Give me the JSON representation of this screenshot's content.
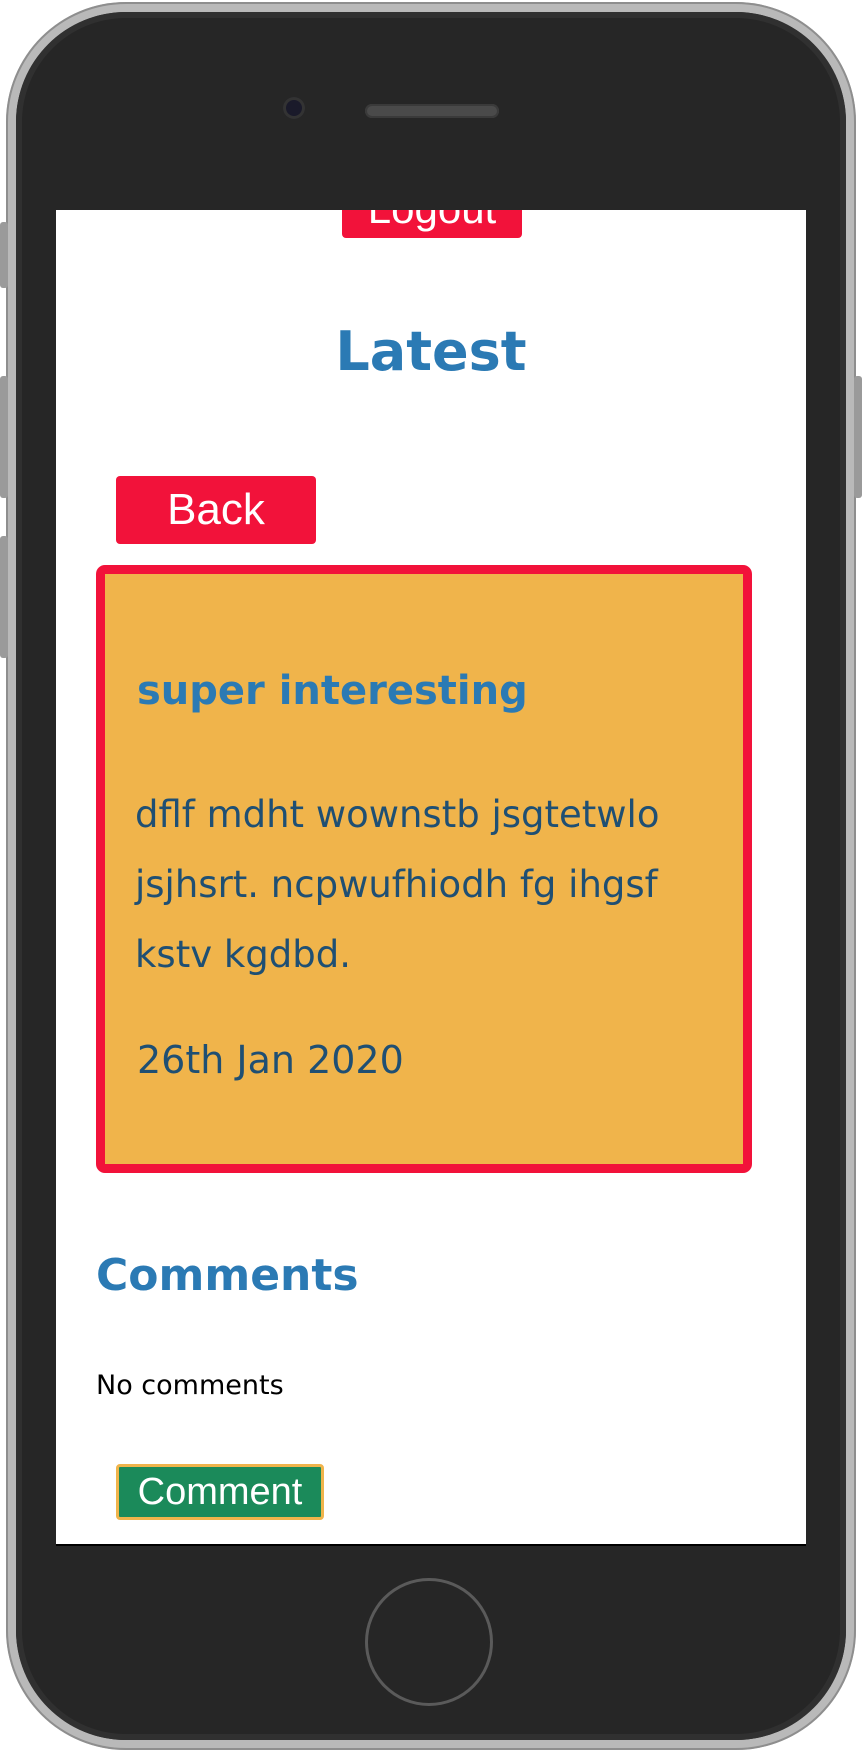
{
  "header": {
    "logout_label": "Logout",
    "title": "Latest"
  },
  "navigation": {
    "back_label": "Back"
  },
  "post": {
    "title": "super interesting",
    "body": "dflf mdht wownstb jsgtetwlo jsjhsrt. ncpwufhiodh fg ihgsf kstv kgdbd.",
    "date": "26th Jan 2020"
  },
  "comments": {
    "heading": "Comments",
    "empty_text": "No comments",
    "comment_label": "Comment"
  },
  "colors": {
    "accent_red": "#f2123a",
    "card_background": "#f0b44b",
    "heading_blue": "#2b7ab4",
    "comment_green": "#1b8a5a"
  }
}
